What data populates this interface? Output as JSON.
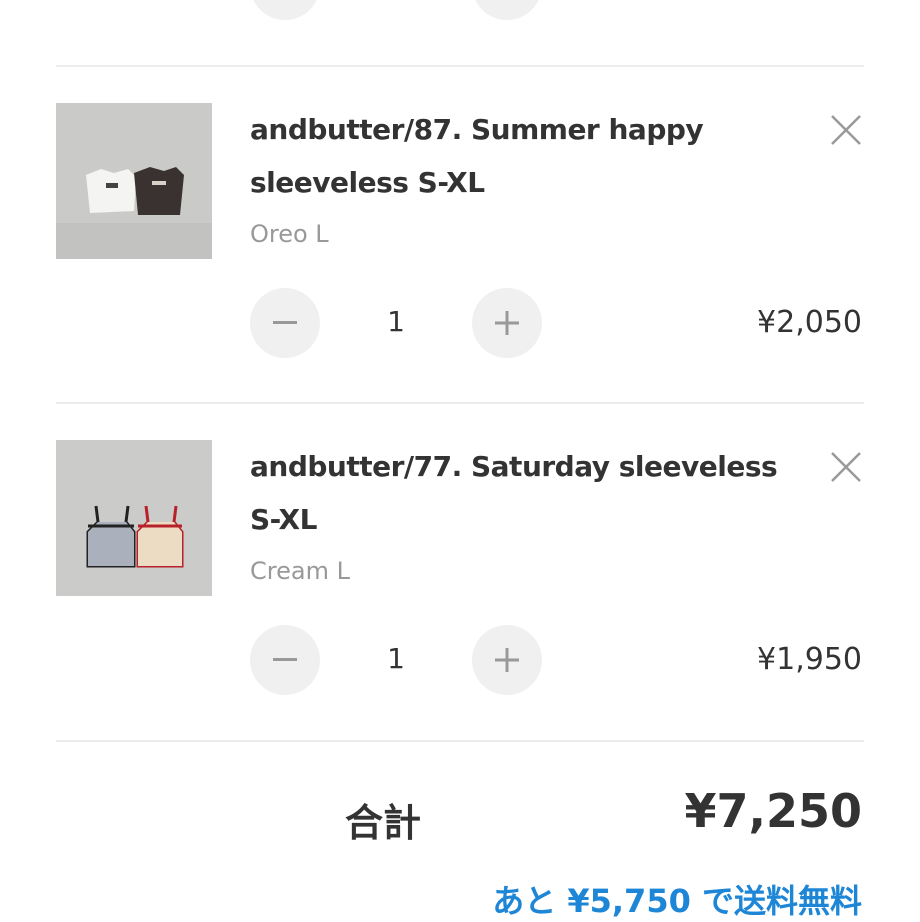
{
  "cart": {
    "items": [
      {
        "title": "andbutter/87. Summer happy sleeveless S-XL",
        "variant": "Oreo L",
        "quantity": "1",
        "price": "¥2,050",
        "image_icon": "product-photo"
      },
      {
        "title": "andbutter/77. Saturday sleeveless S-XL",
        "variant": "Cream L",
        "quantity": "1",
        "price": "¥1,950",
        "image_icon": "product-photo"
      }
    ],
    "total_label": "合計",
    "total_value": "¥7,250",
    "shipping_notice": "あと ¥5,750 で送料無料"
  },
  "colors": {
    "accent_blue": "#1e86d6",
    "text": "#333333",
    "muted": "#999999",
    "button_bg": "#f0f0f0"
  }
}
